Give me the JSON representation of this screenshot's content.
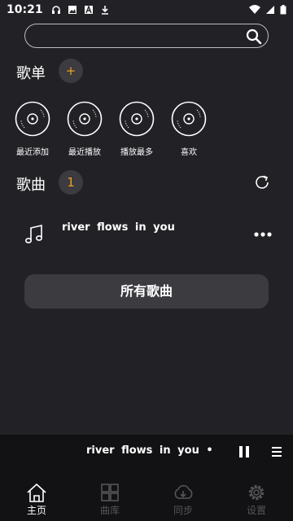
{
  "status_bar": {
    "time": "10:21",
    "icons": [
      "headphones-icon",
      "image-icon",
      "a-icon",
      "download-icon"
    ],
    "right_icons": [
      "wifi-icon",
      "signal-icon",
      "battery-icon"
    ]
  },
  "search": {
    "placeholder": "",
    "value": ""
  },
  "playlists_section": {
    "title": "歌单",
    "add_label": "+"
  },
  "playlists": [
    {
      "label": "最近添加"
    },
    {
      "label": "最近播放"
    },
    {
      "label": "播放最多"
    },
    {
      "label": "喜欢"
    }
  ],
  "songs_section": {
    "title": "歌曲",
    "count": "1"
  },
  "songs": [
    {
      "title": "river flows in you"
    }
  ],
  "all_songs_button": "所有歌曲",
  "now_playing": {
    "title": "river flows in you •"
  },
  "bottom_nav": [
    {
      "label": "主页",
      "icon": "home-icon",
      "active": true
    },
    {
      "label": "曲库",
      "icon": "library-icon",
      "active": false
    },
    {
      "label": "同步",
      "icon": "sync-icon",
      "active": false
    },
    {
      "label": "设置",
      "icon": "settings-icon",
      "active": false
    }
  ],
  "colors": {
    "background": "#222226",
    "accent": "#f0a020",
    "badge_bg": "#3b3b40",
    "inactive": "#555558"
  }
}
